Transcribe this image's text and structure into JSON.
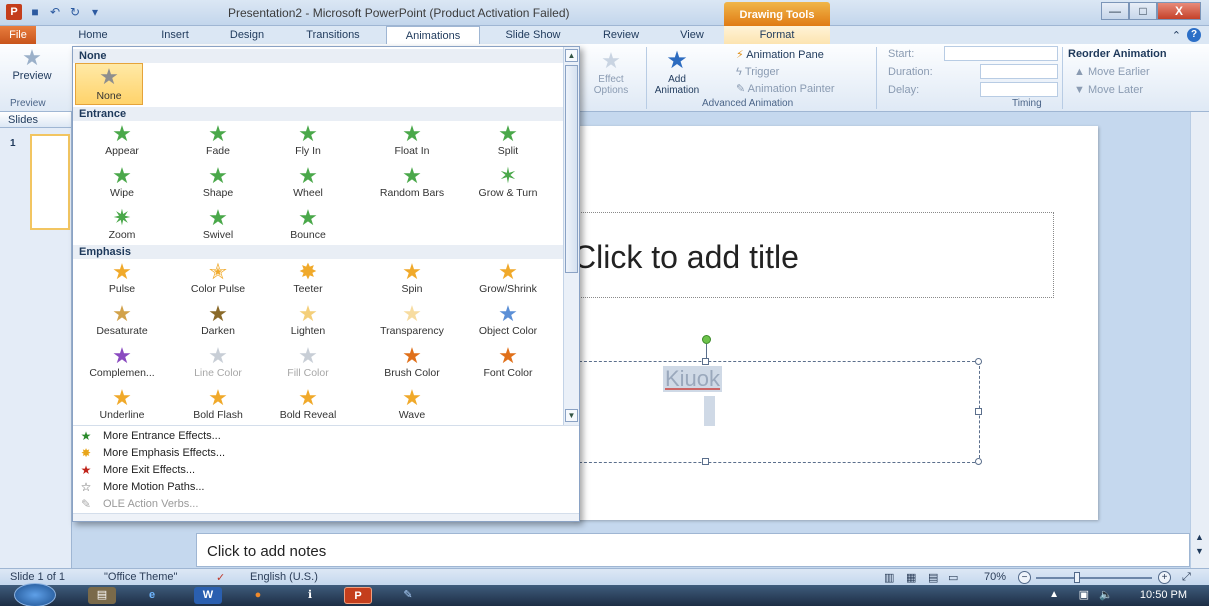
{
  "window": {
    "title": "Presentation2 - Microsoft PowerPoint (Product Activation Failed)",
    "context_tab_group": "Drawing Tools",
    "minimize": "—",
    "maximize": "□",
    "close": "X"
  },
  "tabs": [
    "File",
    "Home",
    "Insert",
    "Design",
    "Transitions",
    "Animations",
    "Slide Show",
    "Review",
    "View",
    "Format"
  ],
  "active_tab": "Animations",
  "ribbon": {
    "preview_label": "Preview",
    "preview_group": "Preview",
    "effect_options": "Effect Options",
    "add_animation": "Add Animation",
    "animation_pane": "Animation Pane",
    "trigger": "Trigger",
    "animation_painter": "Animation Painter",
    "advanced_group": "Advanced Animation",
    "start_label": "Start:",
    "duration_label": "Duration:",
    "delay_label": "Delay:",
    "timing_group": "Timing",
    "reorder": "Reorder Animation",
    "move_earlier": "Move Earlier",
    "move_later": "Move Later"
  },
  "slides_pane": {
    "header": "Slides",
    "slide_number": "1"
  },
  "slide": {
    "title_placeholder": "Click to add title",
    "content_text": "Kiuok"
  },
  "notes_placeholder": "Click to add notes",
  "status": {
    "slide_info": "Slide 1 of 1",
    "theme": "\"Office Theme\"",
    "language": "English (U.S.)",
    "zoom": "70%"
  },
  "taskbar": {
    "clock": "10:50 PM"
  },
  "gallery": {
    "none_header": "None",
    "none_label": "None",
    "entrance_header": "Entrance",
    "entrance": [
      "Appear",
      "Fade",
      "Fly In",
      "Float In",
      "Split",
      "Wipe",
      "Shape",
      "Wheel",
      "Random Bars",
      "Grow & Turn",
      "Zoom",
      "Swivel",
      "Bounce"
    ],
    "emphasis_header": "Emphasis",
    "emphasis": [
      "Pulse",
      "Color Pulse",
      "Teeter",
      "Spin",
      "Grow/Shrink",
      "Desaturate",
      "Darken",
      "Lighten",
      "Transparency",
      "Object Color",
      "Complemen...",
      "Line Color",
      "Fill Color",
      "Brush Color",
      "Font Color",
      "Underline",
      "Bold Flash",
      "Bold Reveal",
      "Wave"
    ],
    "more": [
      "More Entrance Effects...",
      "More Emphasis Effects...",
      "More Exit Effects...",
      "More Motion Paths...",
      "OLE Action Verbs..."
    ]
  }
}
